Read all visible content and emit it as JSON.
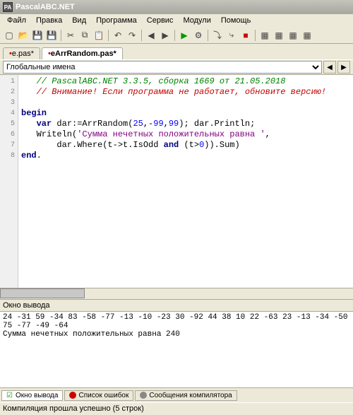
{
  "window": {
    "title": "PascalABC.NET",
    "icon_label": "PA"
  },
  "menu": {
    "items": [
      "Файл",
      "Правка",
      "Вид",
      "Программа",
      "Сервис",
      "Модули",
      "Помощь"
    ]
  },
  "tabs": {
    "items": [
      {
        "label": "e.pas",
        "modified": true,
        "active": false
      },
      {
        "label": "eArrRandom.pas",
        "modified": true,
        "active": true
      }
    ]
  },
  "navbar": {
    "scope": "Глобальные имена"
  },
  "code": {
    "lines": [
      {
        "n": 1,
        "seg": [
          {
            "c": "comment",
            "t": "   // PascalABC.NET 3.3.5, сборка 1669 от 21.05.2018"
          }
        ]
      },
      {
        "n": 2,
        "seg": [
          {
            "c": "comment-red",
            "t": "   // Внимание! Если программа не работает, обновите версию!"
          }
        ]
      },
      {
        "n": 3,
        "seg": [
          {
            "c": "",
            "t": ""
          }
        ]
      },
      {
        "n": 4,
        "fold": "⊟",
        "seg": [
          {
            "c": "kw",
            "t": "begin"
          }
        ]
      },
      {
        "n": 5,
        "seg": [
          {
            "c": "",
            "t": "   "
          },
          {
            "c": "kw",
            "t": "var"
          },
          {
            "c": "",
            "t": " dar:=ArrRandom("
          },
          {
            "c": "num",
            "t": "25"
          },
          {
            "c": "",
            "t": ",-"
          },
          {
            "c": "num",
            "t": "99"
          },
          {
            "c": "",
            "t": ","
          },
          {
            "c": "num",
            "t": "99"
          },
          {
            "c": "",
            "t": "); dar.Println;"
          }
        ]
      },
      {
        "n": 6,
        "seg": [
          {
            "c": "",
            "t": "   Writeln("
          },
          {
            "c": "str",
            "t": "'Сумма нечетных положительных равна '"
          },
          {
            "c": "",
            "t": ","
          }
        ]
      },
      {
        "n": 7,
        "seg": [
          {
            "c": "",
            "t": "       dar.Where(t->t.IsOdd "
          },
          {
            "c": "kw",
            "t": "and"
          },
          {
            "c": "",
            "t": " (t>"
          },
          {
            "c": "num",
            "t": "0"
          },
          {
            "c": "",
            "t": ")).Sum)"
          }
        ]
      },
      {
        "n": 8,
        "seg": [
          {
            "c": "kw",
            "t": "end"
          },
          {
            "c": "",
            "t": "."
          }
        ]
      }
    ]
  },
  "output": {
    "title": "Окно вывода",
    "text": "24 -31 59 -34 83 -58 -77 -13 -10 -23 30 -92 44 38 10 22 -63 23 -13 -34 -50 75 -77 -49 -64\nСумма нечетных положительных равна 240"
  },
  "bottom_tabs": {
    "items": [
      {
        "label": "Окно вывода",
        "checked": true
      },
      {
        "label": "Список ошибок",
        "color": "#c00"
      },
      {
        "label": "Сообщения компилятора",
        "color": "#888"
      }
    ]
  },
  "status": {
    "text": "Компиляция прошла успешно (5 строк)"
  }
}
